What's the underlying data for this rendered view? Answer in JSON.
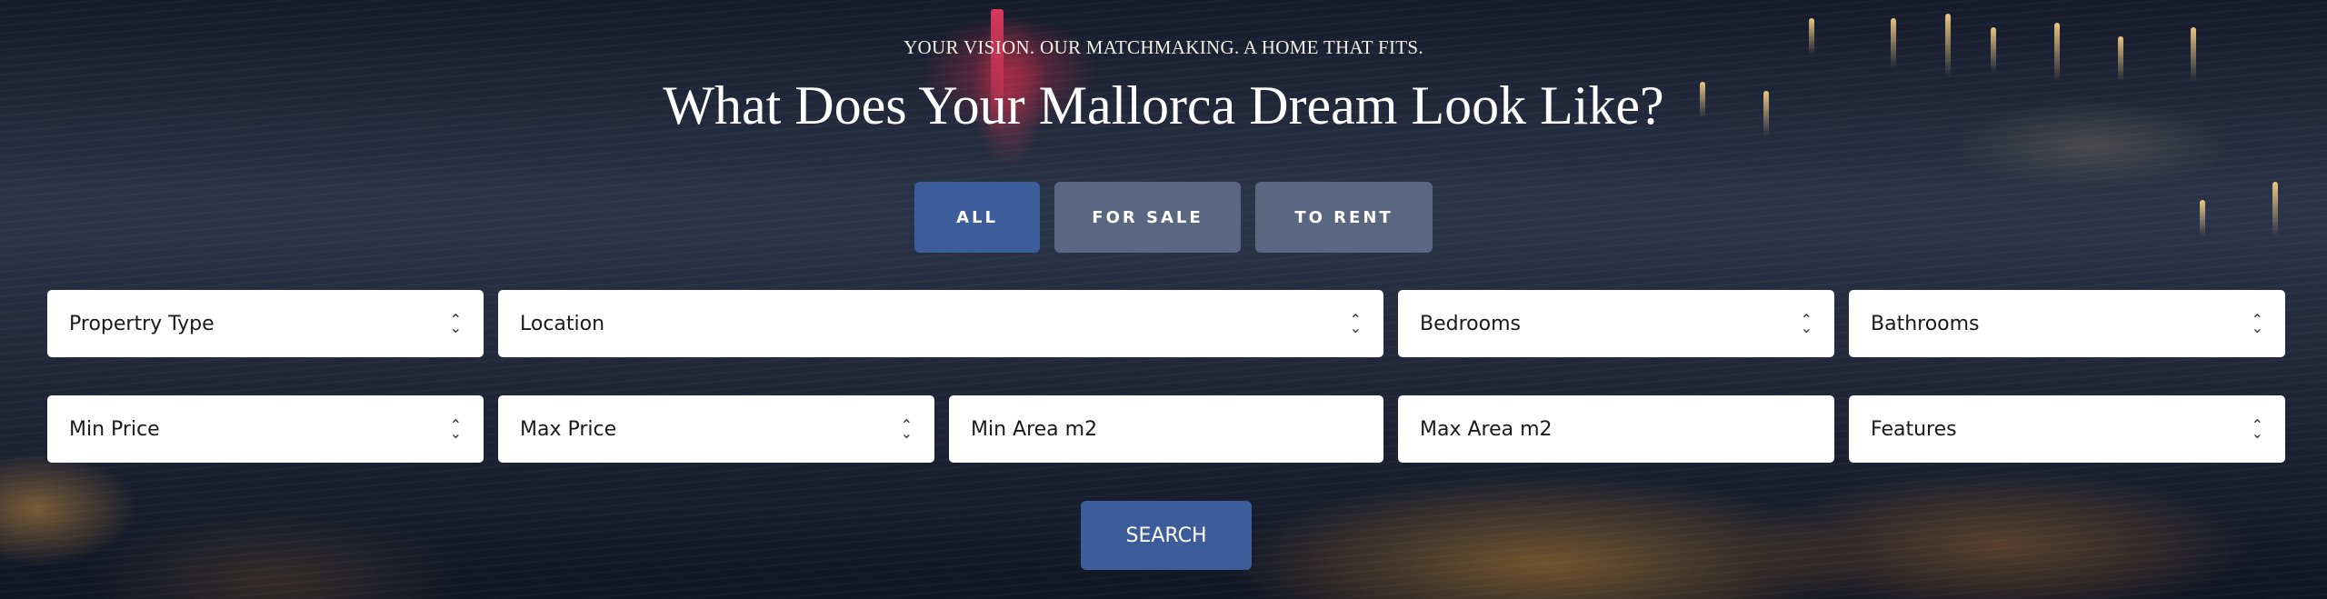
{
  "hero": {
    "tagline": "YOUR VISION. OUR MATCHMAKING. A HOME THAT FITS.",
    "headline": "What Does Your Mallorca Dream Look Like?"
  },
  "tabs": [
    {
      "label": "ALL",
      "active": true
    },
    {
      "label": "FOR SALE",
      "active": false
    },
    {
      "label": "TO RENT",
      "active": false
    }
  ],
  "filters": {
    "property_type": "Propertry Type",
    "location": "Location",
    "bedrooms": "Bedrooms",
    "bathrooms": "Bathrooms",
    "min_price": "Min Price",
    "max_price": "Max Price",
    "min_area_placeholder": "Min Area m2",
    "max_area_placeholder": "Max Area m2",
    "features": "Features"
  },
  "search_button": "SEARCH",
  "colors": {
    "accent": "#3d5d9a",
    "tab_inactive": "#5b6680",
    "field_bg": "#ffffff"
  }
}
